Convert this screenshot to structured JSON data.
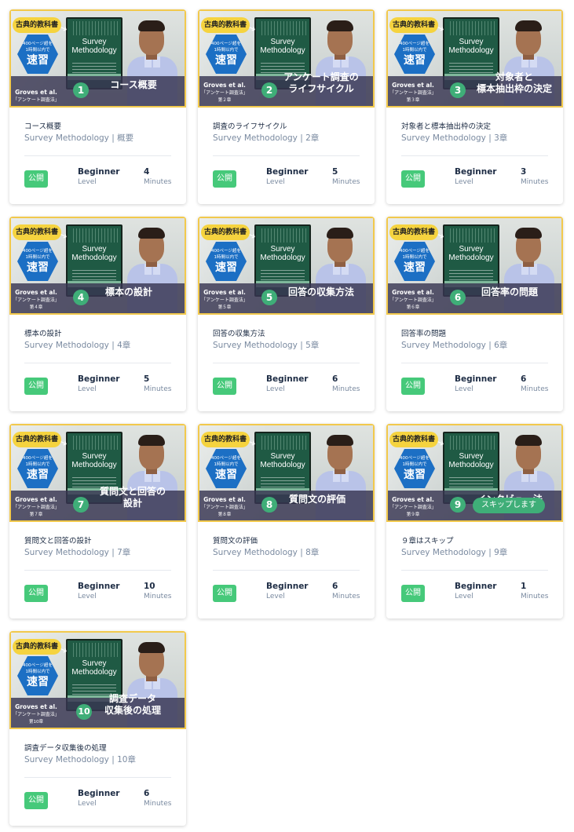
{
  "shared": {
    "badge": "古典的教科書",
    "hex_small": "400ページ超を\n1時間以内で",
    "hex_big": "速習",
    "book_title": "Survey\nMethodology",
    "groves_author": "Groves et al.",
    "groves_book": "「アンケート調査法」",
    "subtitle_prefix": "Survey Methodology",
    "status": "公開",
    "level_value": "Beginner",
    "level_label": "Level",
    "minutes_label": "Minutes"
  },
  "cards": [
    {
      "num": "1",
      "thumb_title": "コース概要",
      "chapter_tag": "",
      "title": "コース概要",
      "subtitle": "Survey Methodology | 概要",
      "minutes": "4"
    },
    {
      "num": "2",
      "thumb_title": "アンケート調査の\nライフサイクル",
      "chapter_tag": "第２章",
      "title": "調査のライフサイクル",
      "subtitle": "Survey Methodology | 2章",
      "minutes": "5"
    },
    {
      "num": "3",
      "thumb_title": "対象者と\n標本抽出枠の決定",
      "chapter_tag": "第３章",
      "title": "対象者と標本抽出枠の決定",
      "subtitle": "Survey Methodology | 3章",
      "minutes": "3"
    },
    {
      "num": "4",
      "thumb_title": "標本の設計",
      "chapter_tag": "第４章",
      "title": "標本の設計",
      "subtitle": "Survey Methodology | 4章",
      "minutes": "5"
    },
    {
      "num": "5",
      "thumb_title": "回答の収集方法",
      "chapter_tag": "第５章",
      "title": "回答の収集方法",
      "subtitle": "Survey Methodology | 5章",
      "minutes": "6"
    },
    {
      "num": "6",
      "thumb_title": "回答率の問題",
      "chapter_tag": "第６章",
      "title": "回答率の問題",
      "subtitle": "Survey Methodology | 6章",
      "minutes": "6"
    },
    {
      "num": "7",
      "thumb_title": "質問文と回答の\n設計",
      "chapter_tag": "第７章",
      "title": "質問文と回答の設計",
      "subtitle": "Survey Methodology | 7章",
      "minutes": "10"
    },
    {
      "num": "8",
      "thumb_title": "質問文の評価",
      "chapter_tag": "第８章",
      "title": "質問文の評価",
      "subtitle": "Survey Methodology | 8章",
      "minutes": "6"
    },
    {
      "num": "9",
      "thumb_title": "インタビュー法",
      "chapter_tag": "第９章",
      "title": "９章はスキップ",
      "subtitle": "Survey Methodology | 9章",
      "minutes": "1",
      "skip_bubble": "スキップします"
    },
    {
      "num": "10",
      "thumb_title": "調査データ\n収集後の処理",
      "chapter_tag": "第10章",
      "title": "調査データ収集後の処理",
      "subtitle": "Survey Methodology | 10章",
      "minutes": "6"
    }
  ],
  "colors": {
    "frame": "#f2c94c",
    "number_circle": "#3fae78",
    "status_badge": "#46c97a",
    "hex": "#1c6fc4"
  },
  "icons": [
    "arrow-icon"
  ]
}
